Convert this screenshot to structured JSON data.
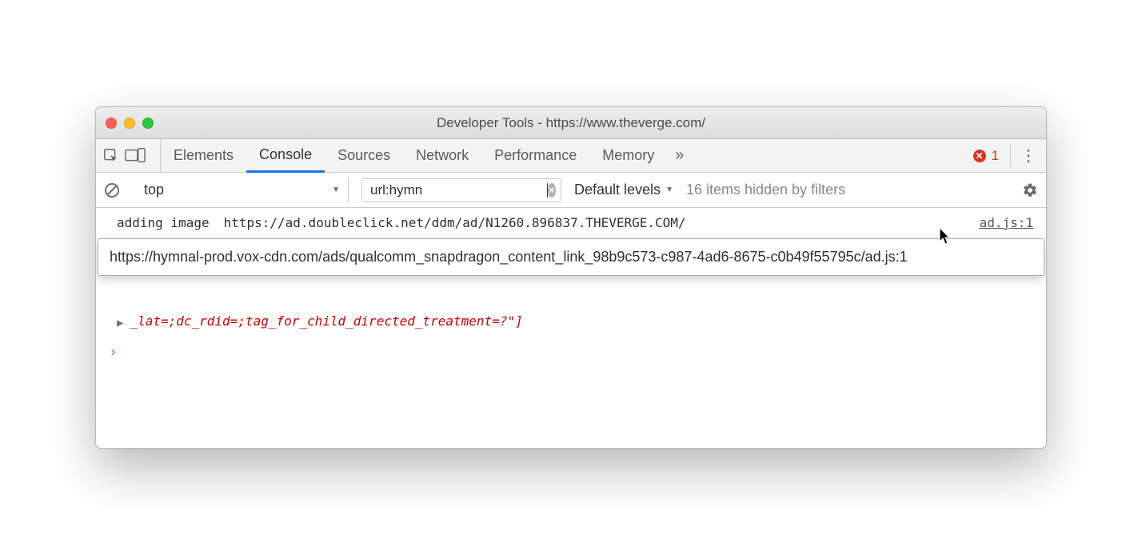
{
  "window": {
    "title": "Developer Tools - https://www.theverge.com/"
  },
  "tabs": {
    "items": [
      "Elements",
      "Console",
      "Sources",
      "Network",
      "Performance",
      "Memory"
    ],
    "active_index": 1,
    "more_glyph": "»"
  },
  "errors": {
    "count": "1"
  },
  "filterbar": {
    "context": "top",
    "filter_value": "url:hymn",
    "levels_label": "Default levels",
    "hidden_msg": "16 items hidden by filters"
  },
  "log": {
    "label": "adding image",
    "url": "https://ad.doubleclick.net/ddm/ad/N1260.896837.THEVERGE.COM/",
    "source": "ad.js:1"
  },
  "tooltip": "https://hymnal-prod.vox-cdn.com/ads/qualcomm_snapdragon_content_link_98b9c573-c987-4ad6-8675-c0b49f55795c/ad.js:1",
  "errorlog": {
    "text": "_lat=;dc_rdid=;tag_for_child_directed_treatment=?\"]"
  },
  "prompt_glyph": "›"
}
